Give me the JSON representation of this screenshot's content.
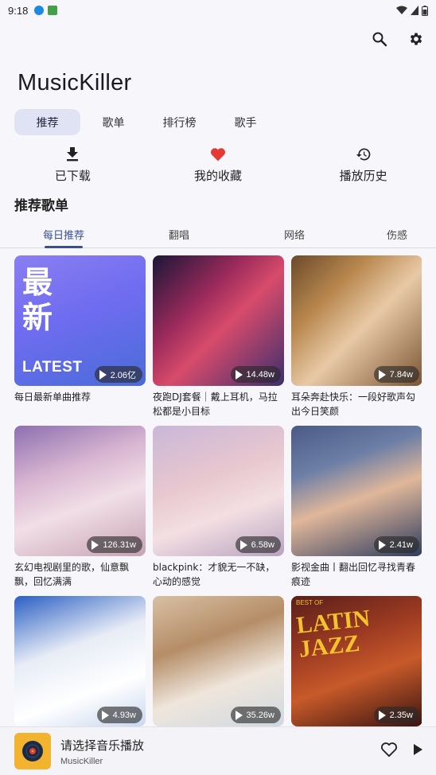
{
  "status_bar": {
    "time": "9:18"
  },
  "app": {
    "title": "MusicKiller"
  },
  "top_actions": [
    {
      "name": "search-button",
      "icon": "search-icon"
    },
    {
      "name": "settings-button",
      "icon": "gear-icon"
    }
  ],
  "tabs": [
    {
      "label": "推荐",
      "active": true
    },
    {
      "label": "歌单",
      "active": false
    },
    {
      "label": "排行榜",
      "active": false
    },
    {
      "label": "歌手",
      "active": false
    }
  ],
  "quick_actions": [
    {
      "label": "已下载",
      "icon": "download-icon"
    },
    {
      "label": "我的收藏",
      "icon": "heart-icon"
    },
    {
      "label": "播放历史",
      "icon": "history-icon"
    }
  ],
  "section": {
    "title": "推荐歌单"
  },
  "subtabs": [
    {
      "label": "每日推荐",
      "active": true
    },
    {
      "label": "翻唱",
      "active": false
    },
    {
      "label": "网络",
      "active": false
    },
    {
      "label": "伤感",
      "active": false
    }
  ],
  "playlists": [
    {
      "title": "每日最新单曲推荐",
      "plays": "2.06亿",
      "cover": {
        "bg": "linear-gradient(160deg,#8a7ef2 0%,#6f6cf0 45%,#4a6bd8 100%)",
        "text": "最\n新",
        "sub": "LATEST"
      }
    },
    {
      "title": "夜跑DJ套餐｜戴上耳机，马拉松都是小目标",
      "plays": "14.48w",
      "cover": {
        "bg": "linear-gradient(135deg,#1b1638 0%,#9a2a5b 35%,#d84b6b 55%,#3c2e6e 100%)"
      }
    },
    {
      "title": "耳朵奔赴快乐：一段好歌声勾出今日笑颜",
      "plays": "7.84w",
      "cover": {
        "bg": "linear-gradient(135deg,#6b4a2a 0%,#b9884f 30%,#e8c9a6 55%,#7a5432 100%)"
      }
    },
    {
      "title": "玄幻电视剧里的歌，仙意飘飘，回忆满满",
      "plays": "126.31w",
      "cover": {
        "bg": "linear-gradient(160deg,#8c6fb0 0%,#d9b6d2 35%,#f1dfe6 60%,#c7a3b3 100%)"
      }
    },
    {
      "title": "blackpink：才貌无一不缺，心动的感觉",
      "plays": "6.58w",
      "cover": {
        "bg": "linear-gradient(160deg,#c9b7d8 0%,#e8c7cf 40%,#f3dfe2 65%,#b8a3c0 100%)"
      }
    },
    {
      "title": "影视金曲丨翻出回忆寻找青春痕迹",
      "plays": "2.41w",
      "cover": {
        "bg": "linear-gradient(160deg,#4a5a86 0%,#6d7fa6 30%,#e0b79a 55%,#2f3c5e 100%)"
      }
    },
    {
      "title": "",
      "plays": "4.93w",
      "cover": {
        "bg": "linear-gradient(160deg,#2a5fc4 0%,#e7ecf6 40%,#ffffff 70%,#c9d7ef 100%)"
      }
    },
    {
      "title": "",
      "plays": "35.26w",
      "cover": {
        "bg": "linear-gradient(160deg,#d8c0a4 0%,#b58d67 35%,#efe6dc 65%,#cfd8e0 100%)"
      }
    },
    {
      "title": "",
      "plays": "2.35w",
      "cover": {
        "bg": "linear-gradient(160deg,#5a1f1a 0%,#9c3a22 35%,#c85a2a 60%,#3a1410 100%)",
        "latin": "LATIN\nJAZZ",
        "small": "BEST OF"
      }
    }
  ],
  "player": {
    "title": "请选择音乐播放",
    "subtitle": "MusicKiller",
    "art_icon": "vinyl-record-icon",
    "favorite_icon": "heart-outline-icon",
    "play_icon": "play-icon"
  },
  "colors": {
    "accent": "#37508f",
    "tab_active_bg": "#dfe3f3",
    "heart": "#e53935",
    "player_art_bg": "#f2b32f"
  }
}
